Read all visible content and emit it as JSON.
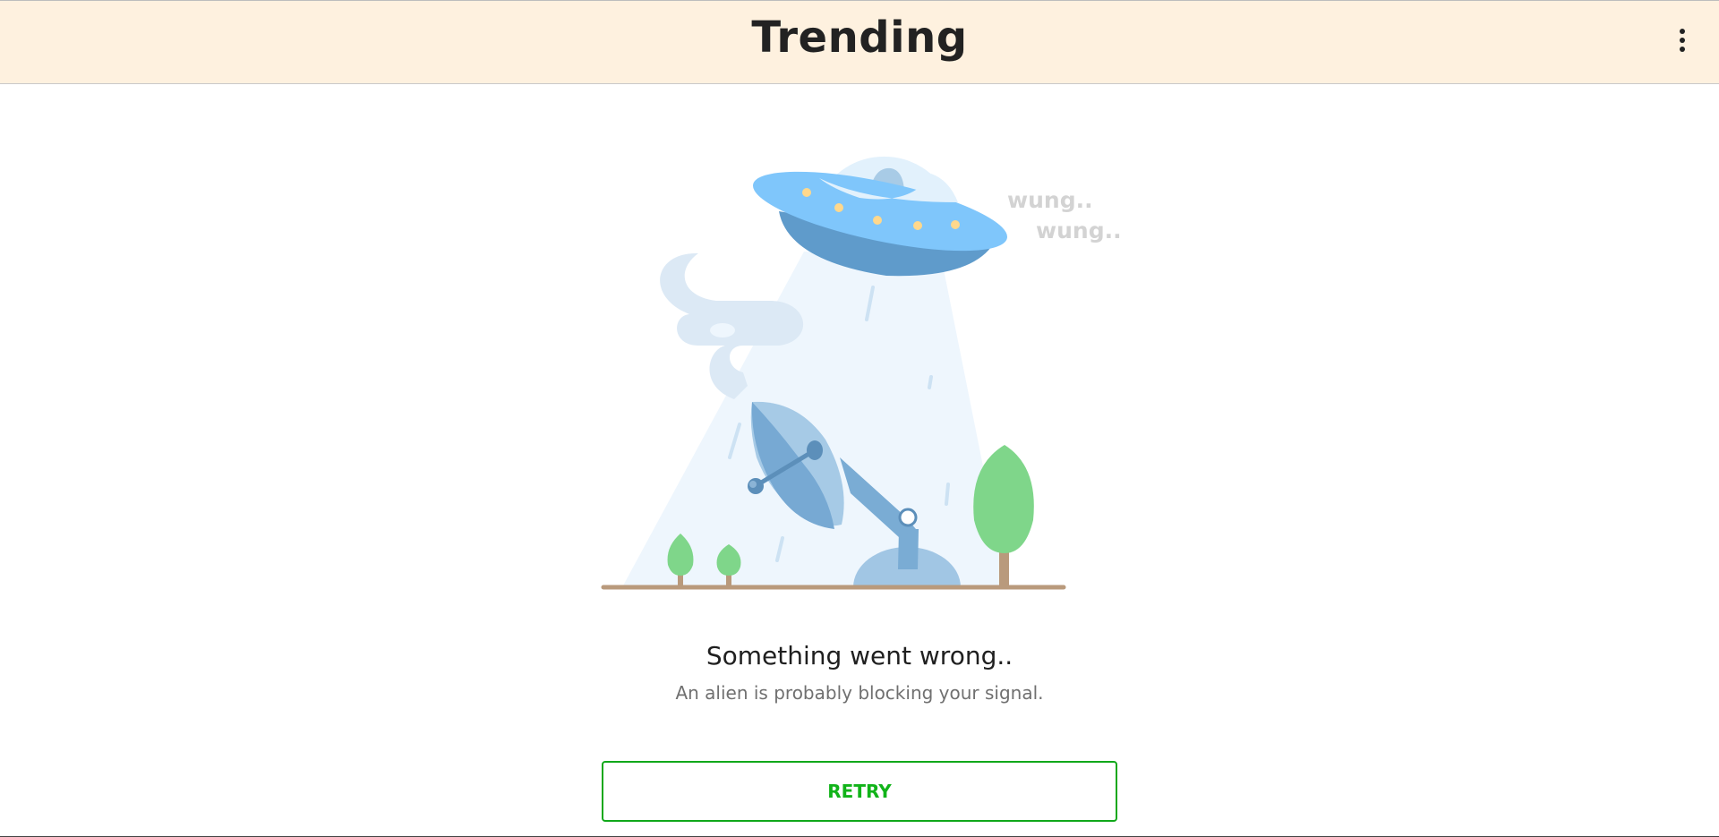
{
  "header": {
    "title": "Trending",
    "menu_icon": "more-vert-icon"
  },
  "illustration": {
    "sound_text_1": "wung..",
    "sound_text_2": "wung.."
  },
  "error": {
    "title": "Something went wrong..",
    "subtitle": "An alien is probably blocking your signal."
  },
  "actions": {
    "retry_label": "RETRY"
  },
  "colors": {
    "header_bg": "#fef1df",
    "retry_accent": "#11b319",
    "ufo_light": "#7fc6fb",
    "ufo_dark": "#5f9bcb",
    "tree_green": "#7fd68a",
    "ground": "#b99a7c"
  }
}
